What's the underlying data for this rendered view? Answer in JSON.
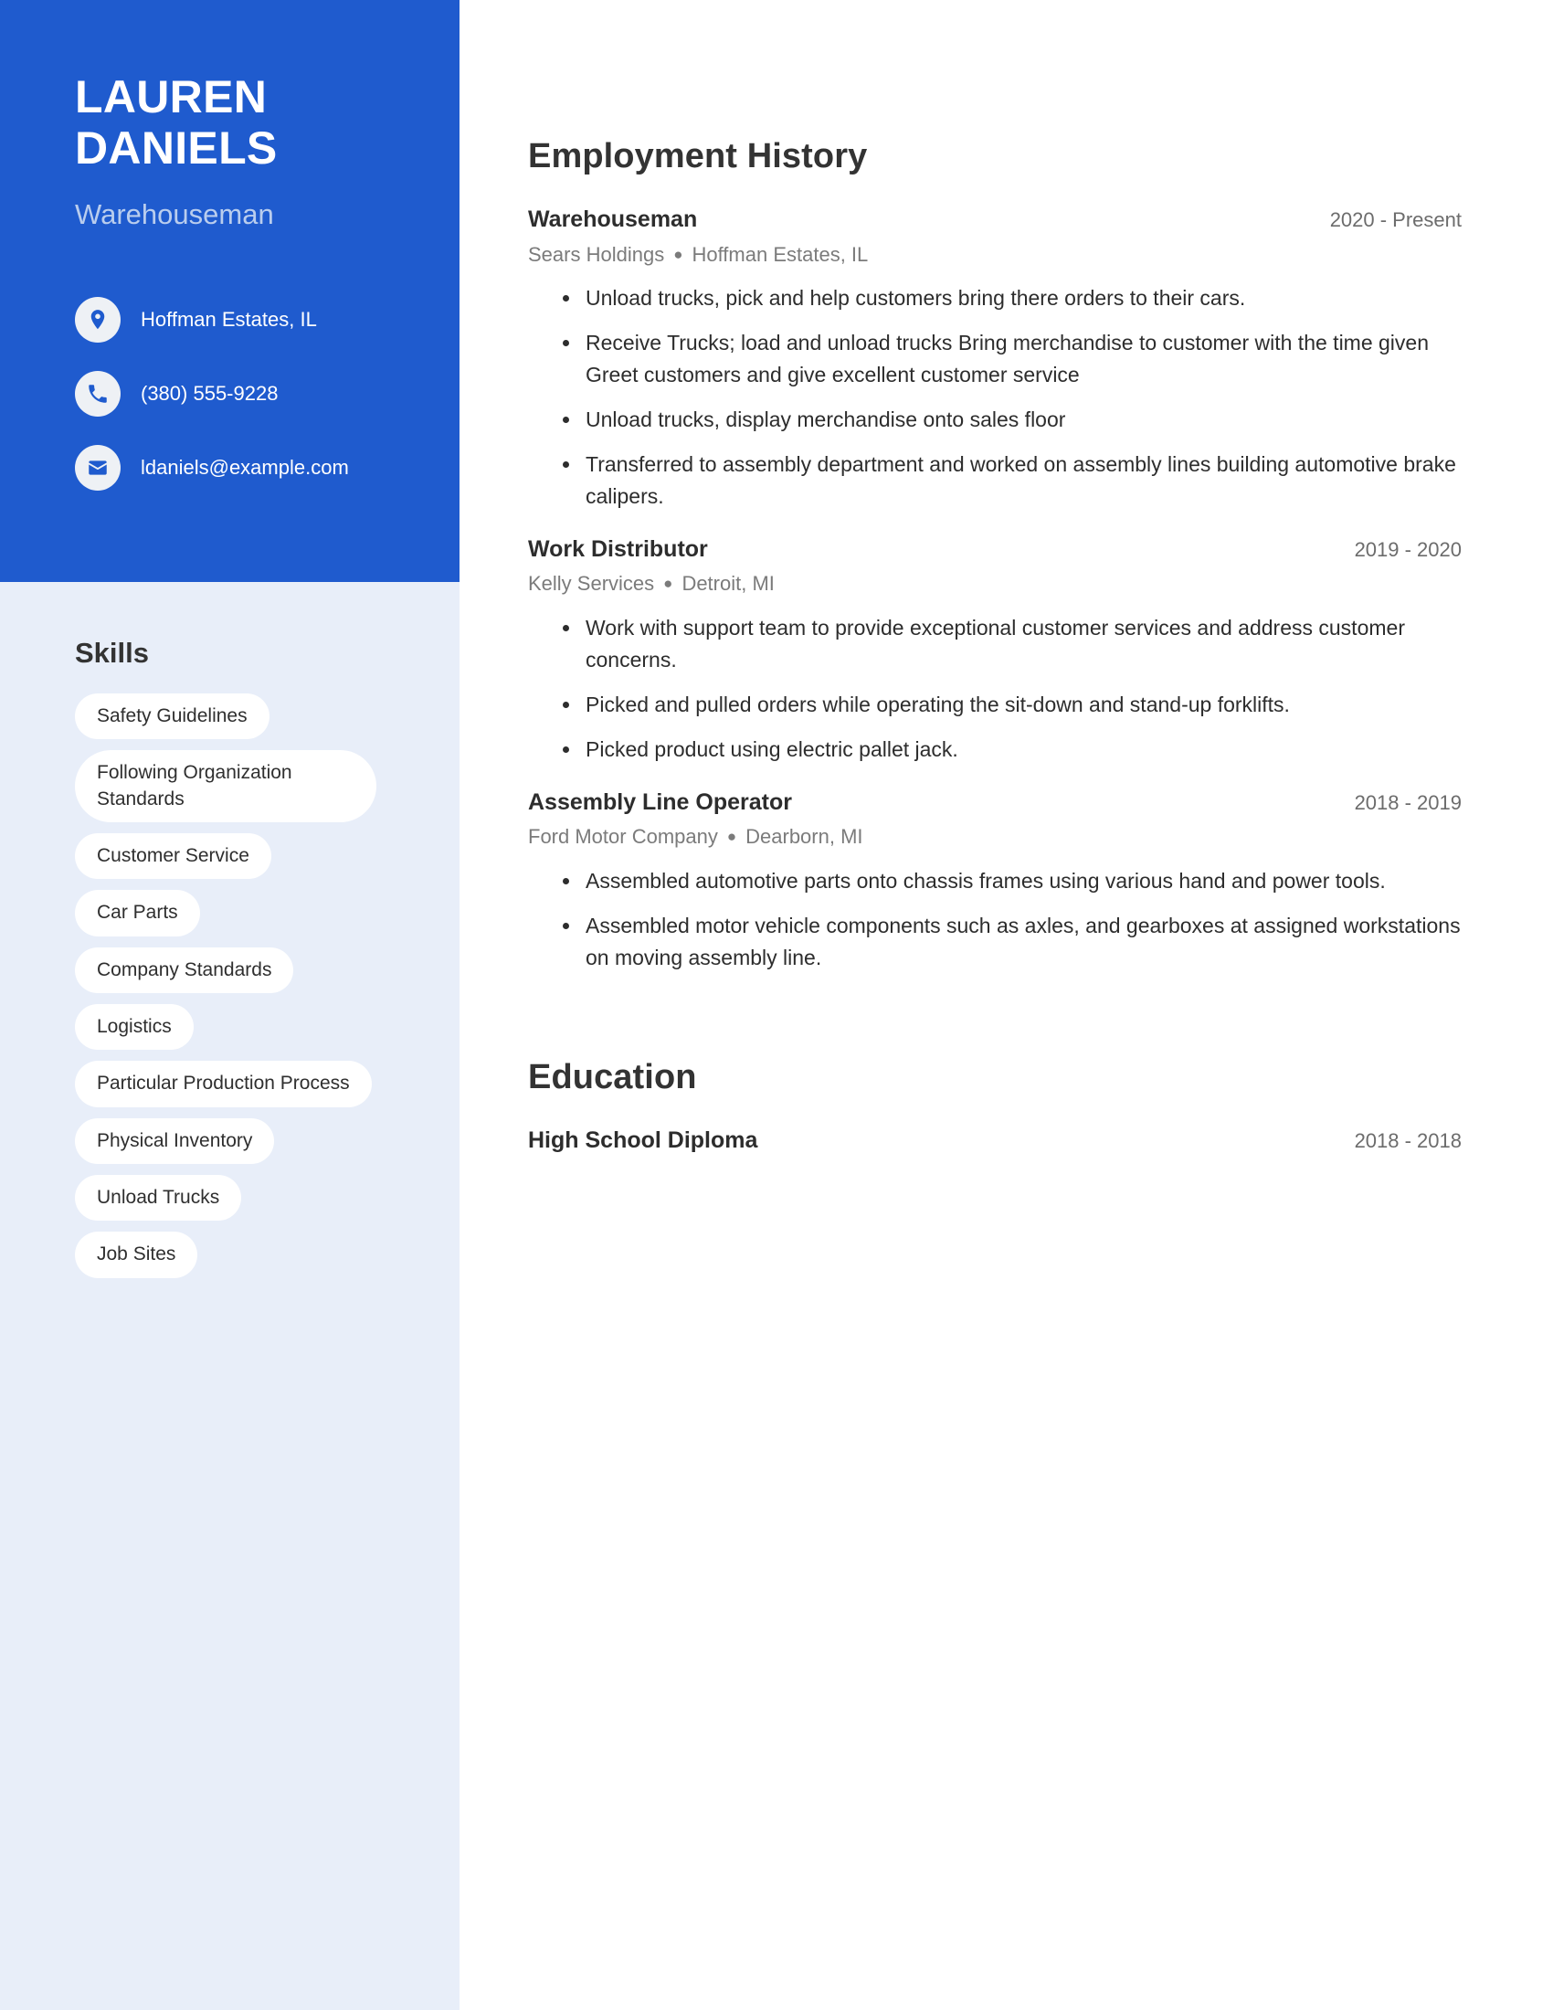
{
  "theme": {
    "primary_blue": "#1f5bce",
    "sidebar_light": "#e8eef9",
    "pill_bg": "#ffffff",
    "heading_color": "#333333",
    "muted_text": "#7b7b7b"
  },
  "sidebar": {
    "name_line1": "LAUREN",
    "name_line2": "DANIELS",
    "job_title": "Warehouseman",
    "contact": [
      {
        "icon": "location-pin-icon",
        "value": "Hoffman Estates, IL"
      },
      {
        "icon": "phone-icon",
        "value": "(380) 555-9228"
      },
      {
        "icon": "envelope-icon",
        "value": "ldaniels@example.com"
      }
    ],
    "skills_heading": "Skills",
    "skills": [
      "Safety Guidelines",
      "Following Organization Standards",
      "Customer Service",
      "Car Parts",
      "Company Standards",
      "Logistics",
      "Particular Production Process",
      "Physical Inventory",
      "Unload Trucks",
      "Job Sites"
    ]
  },
  "main": {
    "employment_heading": "Employment History",
    "education_heading": "Education",
    "jobs": [
      {
        "role": "Warehouseman",
        "date": "2020 - Present",
        "company": "Sears Holdings",
        "location": "Hoffman Estates, IL",
        "bullets": [
          "Unload trucks, pick and help customers bring there orders to their cars.",
          "Receive Trucks; load and unload trucks Bring merchandise to customer with the time given Greet customers and give excellent customer service",
          "Unload trucks, display merchandise onto sales floor",
          "Transferred to assembly department and worked on assembly lines building automotive brake calipers."
        ]
      },
      {
        "role": "Work Distributor",
        "date": "2019 - 2020",
        "company": "Kelly Services",
        "location": "Detroit, MI",
        "bullets": [
          "Work with support team to provide exceptional customer services and address customer concerns.",
          "Picked and pulled orders while operating the sit-down and stand-up forklifts.",
          "Picked product using electric pallet jack."
        ]
      },
      {
        "role": "Assembly Line Operator",
        "date": "2018 - 2019",
        "company": "Ford Motor Company",
        "location": "Dearborn, MI",
        "bullets": [
          "Assembled automotive parts onto chassis frames using various hand and power tools.",
          "Assembled motor vehicle components such as axles, and gearboxes at assigned workstations on moving assembly line."
        ]
      }
    ],
    "education": [
      {
        "degree": "High School Diploma",
        "date": "2018 - 2018"
      }
    ]
  }
}
